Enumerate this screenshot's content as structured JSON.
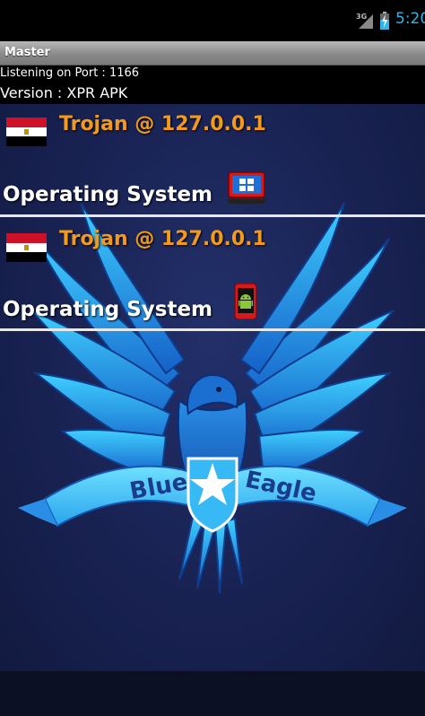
{
  "status_bar": {
    "network": "3G",
    "clock": "5:20",
    "clock_color": "#33b5e5"
  },
  "app": {
    "title": "Master"
  },
  "info": {
    "listening": "Listening on Port : 1166",
    "version": "Version : XPR APK"
  },
  "clients": [
    {
      "flag": "egypt-flag",
      "host": "Trojan @ 127.0.0.1",
      "os_label": "Operating System",
      "os_icon": "windows-laptop-icon"
    },
    {
      "flag": "egypt-flag",
      "host": "Trojan @ 127.0.0.1",
      "os_label": "Operating System",
      "os_icon": "android-phone-icon"
    }
  ],
  "background": {
    "logo_text_1": "Blue",
    "logo_text_2": "Eagle"
  },
  "colors": {
    "host_text": "#f39a1b",
    "accent_blue": "#33b5e5",
    "background_navy": "#1a2456"
  }
}
